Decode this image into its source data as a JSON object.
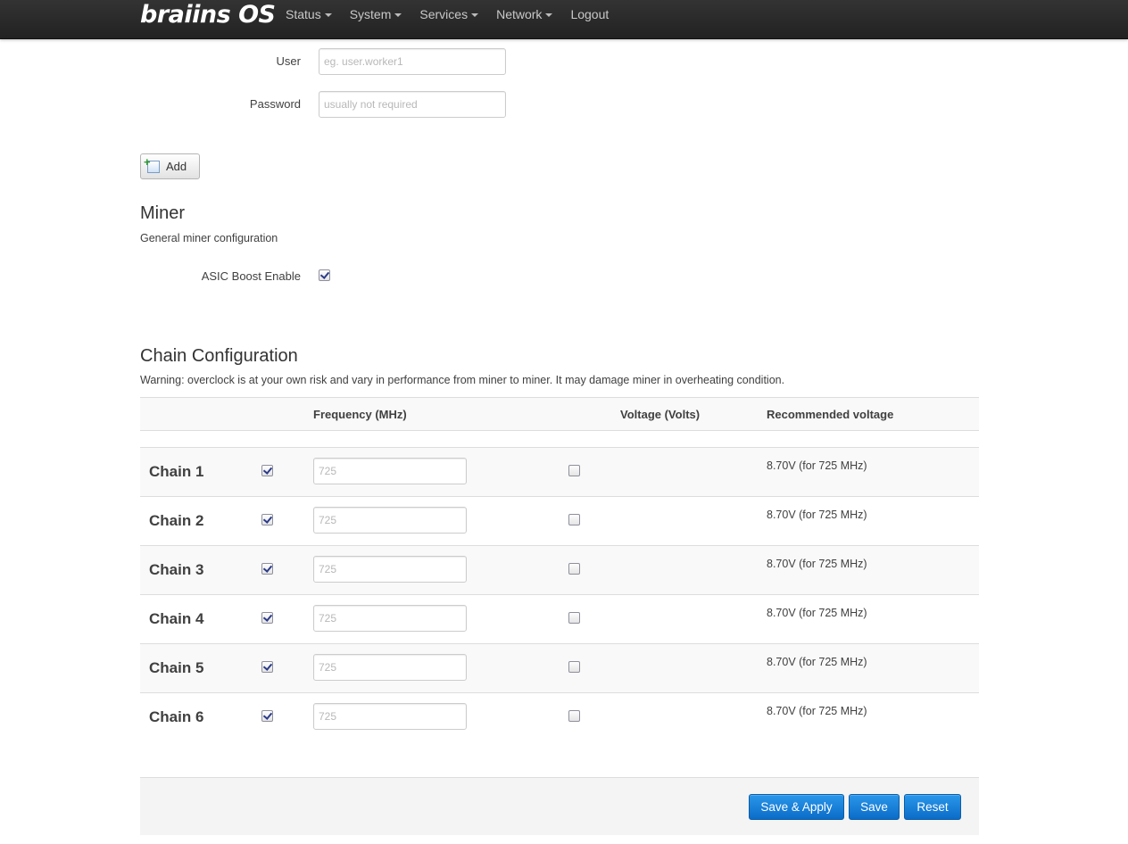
{
  "navbar": {
    "brand": "braiins OS",
    "items": [
      {
        "label": "Status",
        "dropdown": true
      },
      {
        "label": "System",
        "dropdown": true
      },
      {
        "label": "Services",
        "dropdown": true
      },
      {
        "label": "Network",
        "dropdown": true
      },
      {
        "label": "Logout",
        "dropdown": false
      }
    ]
  },
  "pool": {
    "user_label": "User",
    "user_value": "",
    "user_placeholder": "eg. user.worker1",
    "password_label": "Password",
    "password_value": "",
    "password_placeholder": "usually not required",
    "add_label": "Add"
  },
  "miner": {
    "title": "Miner",
    "description": "General miner configuration",
    "asic_boost_label": "ASIC Boost Enable",
    "asic_boost_checked": true
  },
  "chains": {
    "title": "Chain Configuration",
    "warning": "Warning: overclock is at your own risk and vary in performance from miner to miner. It may damage miner in overheating condition.",
    "headers": {
      "frequency": "Frequency (MHz)",
      "voltage": "Voltage (Volts)",
      "recommended": "Recommended voltage"
    },
    "rows": [
      {
        "name": "Chain 1",
        "frequency_enabled": true,
        "frequency_placeholder": "725",
        "voltage_enabled": false,
        "recommended": "8.70V (for 725 MHz)"
      },
      {
        "name": "Chain 2",
        "frequency_enabled": true,
        "frequency_placeholder": "725",
        "voltage_enabled": false,
        "recommended": "8.70V (for 725 MHz)"
      },
      {
        "name": "Chain 3",
        "frequency_enabled": true,
        "frequency_placeholder": "725",
        "voltage_enabled": false,
        "recommended": "8.70V (for 725 MHz)"
      },
      {
        "name": "Chain 4",
        "frequency_enabled": true,
        "frequency_placeholder": "725",
        "voltage_enabled": false,
        "recommended": "8.70V (for 725 MHz)"
      },
      {
        "name": "Chain 5",
        "frequency_enabled": true,
        "frequency_placeholder": "725",
        "voltage_enabled": false,
        "recommended": "8.70V (for 725 MHz)"
      },
      {
        "name": "Chain 6",
        "frequency_enabled": true,
        "frequency_placeholder": "725",
        "voltage_enabled": false,
        "recommended": "8.70V (for 725 MHz)"
      }
    ]
  },
  "actions": {
    "save_apply": "Save & Apply",
    "save": "Save",
    "reset": "Reset"
  },
  "colors": {
    "navbar": "#222222",
    "primary_button": "#0b6cc8",
    "row_stripe": "#f9f9f9"
  }
}
